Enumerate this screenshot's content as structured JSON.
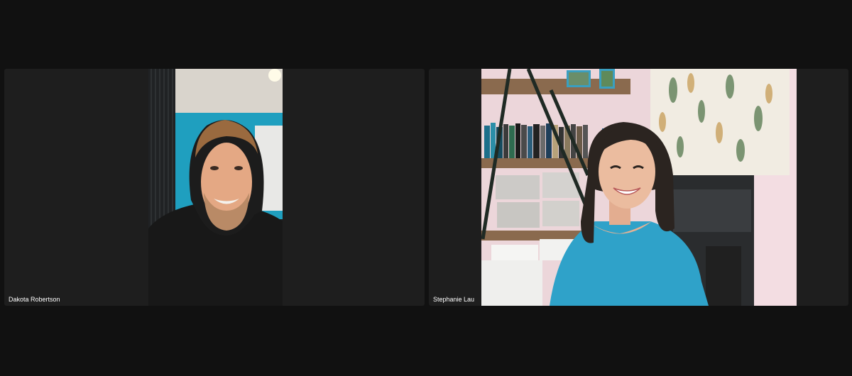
{
  "meeting": {
    "participants": [
      {
        "name": "Dakota Robertson"
      },
      {
        "name": "Stephanie Lau"
      }
    ]
  }
}
